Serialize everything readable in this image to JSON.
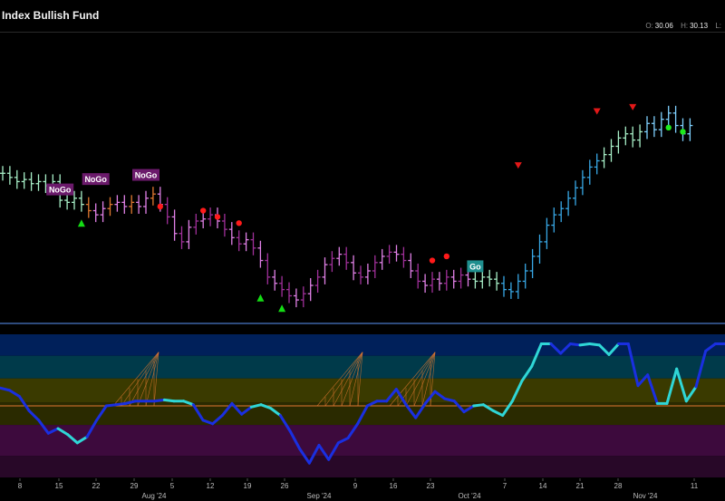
{
  "header": {
    "title": "Index Bullish Fund",
    "ohlc": [
      {
        "k": "O:",
        "v": "30.06"
      },
      {
        "k": "H:",
        "v": "30.13"
      },
      {
        "k": "L:",
        "v": ""
      }
    ]
  },
  "colors": {
    "background": "#000000",
    "nogo_label_bg": "#6b1a6b",
    "go_label_bg": "#1f8f8f",
    "go_strong": "#38a8e6",
    "go_weak": "#7fd1ff",
    "nogo_strong": "#a0309a",
    "nogo_weak": "#e080e6",
    "neutral": "#a8f0c8",
    "transition": "#e07830",
    "osc_line": "#1a2fe0",
    "osc_line_light": "#2fd6d6",
    "osc_zero": "#e07830",
    "divider": "#4a78c8",
    "red_dot": "#ff1a1a",
    "green_dot": "#1eea1e",
    "red_triangle": "#e31818",
    "green_triangle": "#14dc14"
  },
  "chart_data": [
    {
      "type": "line",
      "name": "price",
      "ylim": [
        17.5,
        31.2
      ],
      "x": [
        "Jul 1",
        "Jul 2",
        "Jul 3",
        "Jul 5",
        "Jul 8",
        "Jul 9",
        "Jul 10",
        "Jul 11",
        "Jul 12",
        "Jul 15",
        "Jul 16",
        "Jul 17",
        "Jul 18",
        "Jul 19",
        "Jul 22",
        "Jul 23",
        "Jul 24",
        "Jul 25",
        "Jul 26",
        "Jul 29",
        "Jul 30",
        "Jul 31",
        "Aug 1",
        "Aug 2",
        "Aug 5",
        "Aug 6",
        "Aug 7",
        "Aug 8",
        "Aug 9",
        "Aug 12",
        "Aug 13",
        "Aug 14",
        "Aug 15",
        "Aug 16",
        "Aug 19",
        "Aug 20",
        "Aug 21",
        "Aug 22",
        "Aug 23",
        "Aug 26",
        "Aug 27",
        "Aug 28",
        "Aug 29",
        "Aug 30",
        "Sep 3",
        "Sep 4",
        "Sep 5",
        "Sep 6",
        "Sep 9",
        "Sep 10",
        "Sep 11",
        "Sep 12",
        "Sep 13",
        "Sep 16",
        "Sep 17",
        "Sep 18",
        "Sep 19",
        "Sep 20",
        "Sep 23",
        "Sep 24",
        "Sep 25",
        "Sep 26",
        "Sep 27",
        "Sep 30",
        "Oct 1",
        "Oct 2",
        "Oct 3",
        "Oct 4",
        "Oct 7",
        "Oct 8",
        "Oct 9",
        "Oct 10",
        "Oct 11",
        "Oct 14",
        "Oct 15",
        "Oct 16",
        "Oct 17",
        "Oct 18",
        "Oct 21",
        "Oct 22",
        "Oct 23",
        "Oct 24",
        "Oct 25",
        "Oct 28",
        "Oct 29",
        "Oct 30",
        "Oct 31",
        "Nov 1",
        "Nov 4",
        "Nov 5",
        "Nov 6",
        "Nov 7",
        "Nov 8",
        "Nov 11",
        "Nov 12",
        "Nov 13",
        "Nov 14"
      ],
      "close": [
        24.6,
        24.4,
        24.2,
        24.3,
        24.1,
        24.2,
        24.0,
        24.2,
        23.3,
        23.2,
        23.4,
        23.1,
        22.8,
        22.6,
        22.9,
        23.1,
        23.2,
        23.0,
        23.2,
        23.0,
        23.4,
        23.6,
        23.1,
        22.5,
        21.7,
        21.3,
        22.0,
        22.3,
        22.4,
        22.6,
        22.3,
        21.9,
        21.5,
        21.2,
        21.4,
        21.0,
        20.4,
        19.6,
        19.3,
        19.0,
        18.7,
        18.5,
        18.8,
        19.2,
        19.6,
        20.2,
        20.5,
        20.7,
        20.3,
        19.8,
        19.6,
        19.9,
        20.3,
        20.6,
        20.8,
        20.7,
        20.4,
        19.9,
        19.4,
        19.2,
        19.5,
        19.3,
        19.6,
        19.4,
        19.7,
        19.5,
        19.4,
        19.6,
        19.5,
        19.3,
        19.0,
        18.9,
        19.4,
        19.9,
        20.6,
        21.3,
        22.1,
        22.6,
        22.9,
        23.4,
        23.9,
        24.4,
        24.9,
        25.2,
        25.5,
        25.9,
        26.3,
        26.5,
        26.2,
        26.6,
        27.0,
        26.7,
        27.2,
        27.5,
        26.9,
        26.5,
        26.9
      ],
      "signals": [
        {
          "type": "label",
          "text": "NoGo",
          "at": "Jul 15"
        },
        {
          "type": "label",
          "text": "NoGo",
          "at": "Jul 22"
        },
        {
          "type": "label",
          "text": "NoGo",
          "at": "Jul 29"
        },
        {
          "type": "label",
          "text": "Go",
          "at": "Oct 2"
        }
      ]
    },
    {
      "type": "line",
      "name": "oscillator",
      "ylim": [
        -6,
        6
      ],
      "x_ticks": [
        "8",
        "15",
        "22",
        "29",
        "Aug '24",
        "5",
        "12",
        "19",
        "26",
        "Sep '24",
        "9",
        "16",
        "23",
        "Oct '24",
        "7",
        "14",
        "21",
        "28",
        "Nov '24",
        "11"
      ]
    }
  ],
  "x_axis": {
    "ticks": [
      "8",
      "15",
      "22",
      "29",
      "Aug '24",
      "5",
      "12",
      "19",
      "26",
      "Sep '24",
      "9",
      "16",
      "23",
      "Oct '24",
      "7",
      "14",
      "21",
      "28",
      "Nov '24",
      "11"
    ]
  }
}
